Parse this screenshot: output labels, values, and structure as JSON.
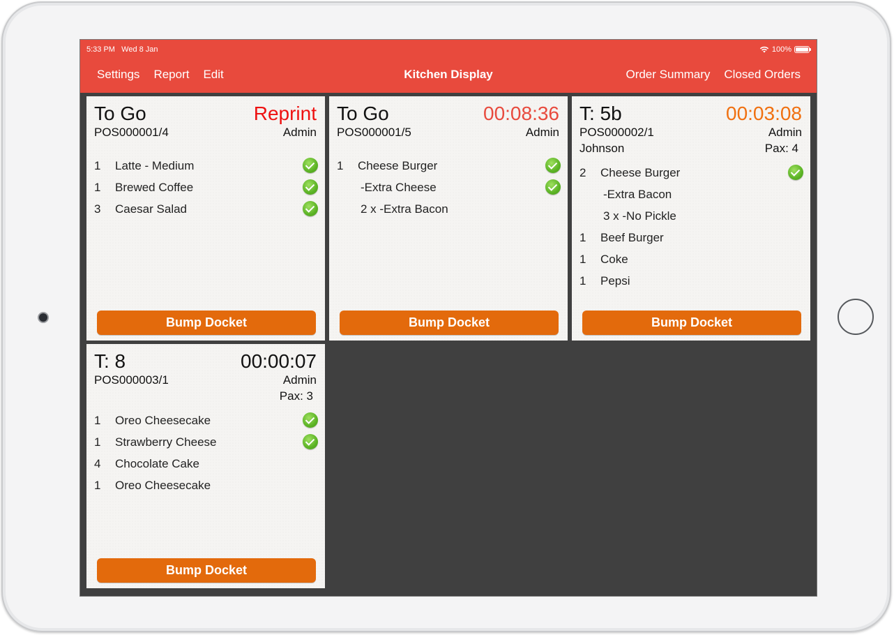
{
  "status_bar": {
    "time": "5:33 PM",
    "date": "Wed 8 Jan",
    "battery": "100%"
  },
  "nav": {
    "left": [
      "Settings",
      "Report",
      "Edit"
    ],
    "title": "Kitchen Display",
    "right": [
      "Order Summary",
      "Closed Orders"
    ]
  },
  "colors": {
    "header": "#e84a3d",
    "bump": "#e36a0c",
    "reprint": "#ee1111",
    "timer_red": "#e84a3d",
    "timer_orange": "#f07010",
    "timer_black": "#111111",
    "check": "#5bb324"
  },
  "dockets": [
    {
      "title": "To Go",
      "status": "Reprint",
      "order": "POS000001/4",
      "user": "Admin",
      "customer": "",
      "pax": "",
      "items": [
        {
          "qty": "1",
          "name": "Latte - Medium",
          "done": true
        },
        {
          "qty": "1",
          "name": "Brewed Coffee",
          "done": true
        },
        {
          "qty": "3",
          "name": "Caesar Salad",
          "done": true
        }
      ],
      "bump_label": "Bump Docket"
    },
    {
      "title": "To Go",
      "status": "00:08:36",
      "order": "POS000001/5",
      "user": "Admin",
      "customer": "",
      "pax": "",
      "items": [
        {
          "qty": "1",
          "name": "Cheese Burger",
          "done": true
        },
        {
          "qty": "",
          "name": "-Extra Cheese",
          "done": true
        },
        {
          "qty": "",
          "name": "2 x -Extra Bacon",
          "done": false
        }
      ],
      "bump_label": "Bump Docket"
    },
    {
      "title": "T: 5b",
      "status": "00:03:08",
      "order": "POS000002/1",
      "user": "Admin",
      "customer": "Johnson",
      "pax": "Pax: 4",
      "items": [
        {
          "qty": "2",
          "name": "Cheese Burger",
          "done": true
        },
        {
          "qty": "",
          "name": "-Extra Bacon",
          "done": false
        },
        {
          "qty": "",
          "name": "3 x -No Pickle",
          "done": false
        },
        {
          "qty": "1",
          "name": "Beef Burger",
          "done": false
        },
        {
          "qty": "1",
          "name": "Coke",
          "done": false
        },
        {
          "qty": "1",
          "name": "Pepsi",
          "done": false
        }
      ],
      "bump_label": "Bump Docket"
    },
    {
      "title": "T: 8",
      "status": "00:00:07",
      "order": "POS000003/1",
      "user": "Admin",
      "customer": "",
      "pax": "Pax: 3",
      "items": [
        {
          "qty": "1",
          "name": "Oreo Cheesecake",
          "done": true
        },
        {
          "qty": "1",
          "name": "Strawberry Cheese",
          "done": true
        },
        {
          "qty": "4",
          "name": "Chocolate Cake",
          "done": false
        },
        {
          "qty": "1",
          "name": "Oreo Cheesecake",
          "done": false
        }
      ],
      "bump_label": "Bump Docket"
    }
  ]
}
